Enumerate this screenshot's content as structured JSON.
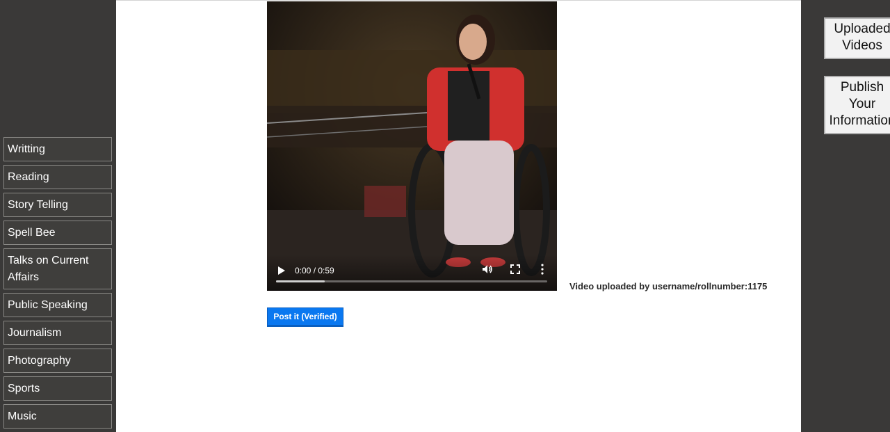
{
  "sidebar": {
    "items": [
      {
        "label": "Writting"
      },
      {
        "label": "Reading"
      },
      {
        "label": "Story Telling"
      },
      {
        "label": "Spell Bee"
      },
      {
        "label": "Talks on Current Affairs"
      },
      {
        "label": "Public Speaking"
      },
      {
        "label": "Journalism"
      },
      {
        "label": "Photography"
      },
      {
        "label": "Sports"
      },
      {
        "label": "Music"
      }
    ]
  },
  "video": {
    "time": "0:00 / 0:59",
    "progress_buffered": 0.18,
    "uploaded_by": "Video uploaded by username/rollnumber:1175"
  },
  "actions": {
    "post_label": "Post it (Verified)"
  },
  "right_panel": {
    "uploaded_videos": "Uploaded\nVideos",
    "publish_info": "Publish\nYour\nInformation"
  },
  "colors": {
    "sidebar_bg": "#3a3938",
    "post_button": "#0a78f0"
  }
}
